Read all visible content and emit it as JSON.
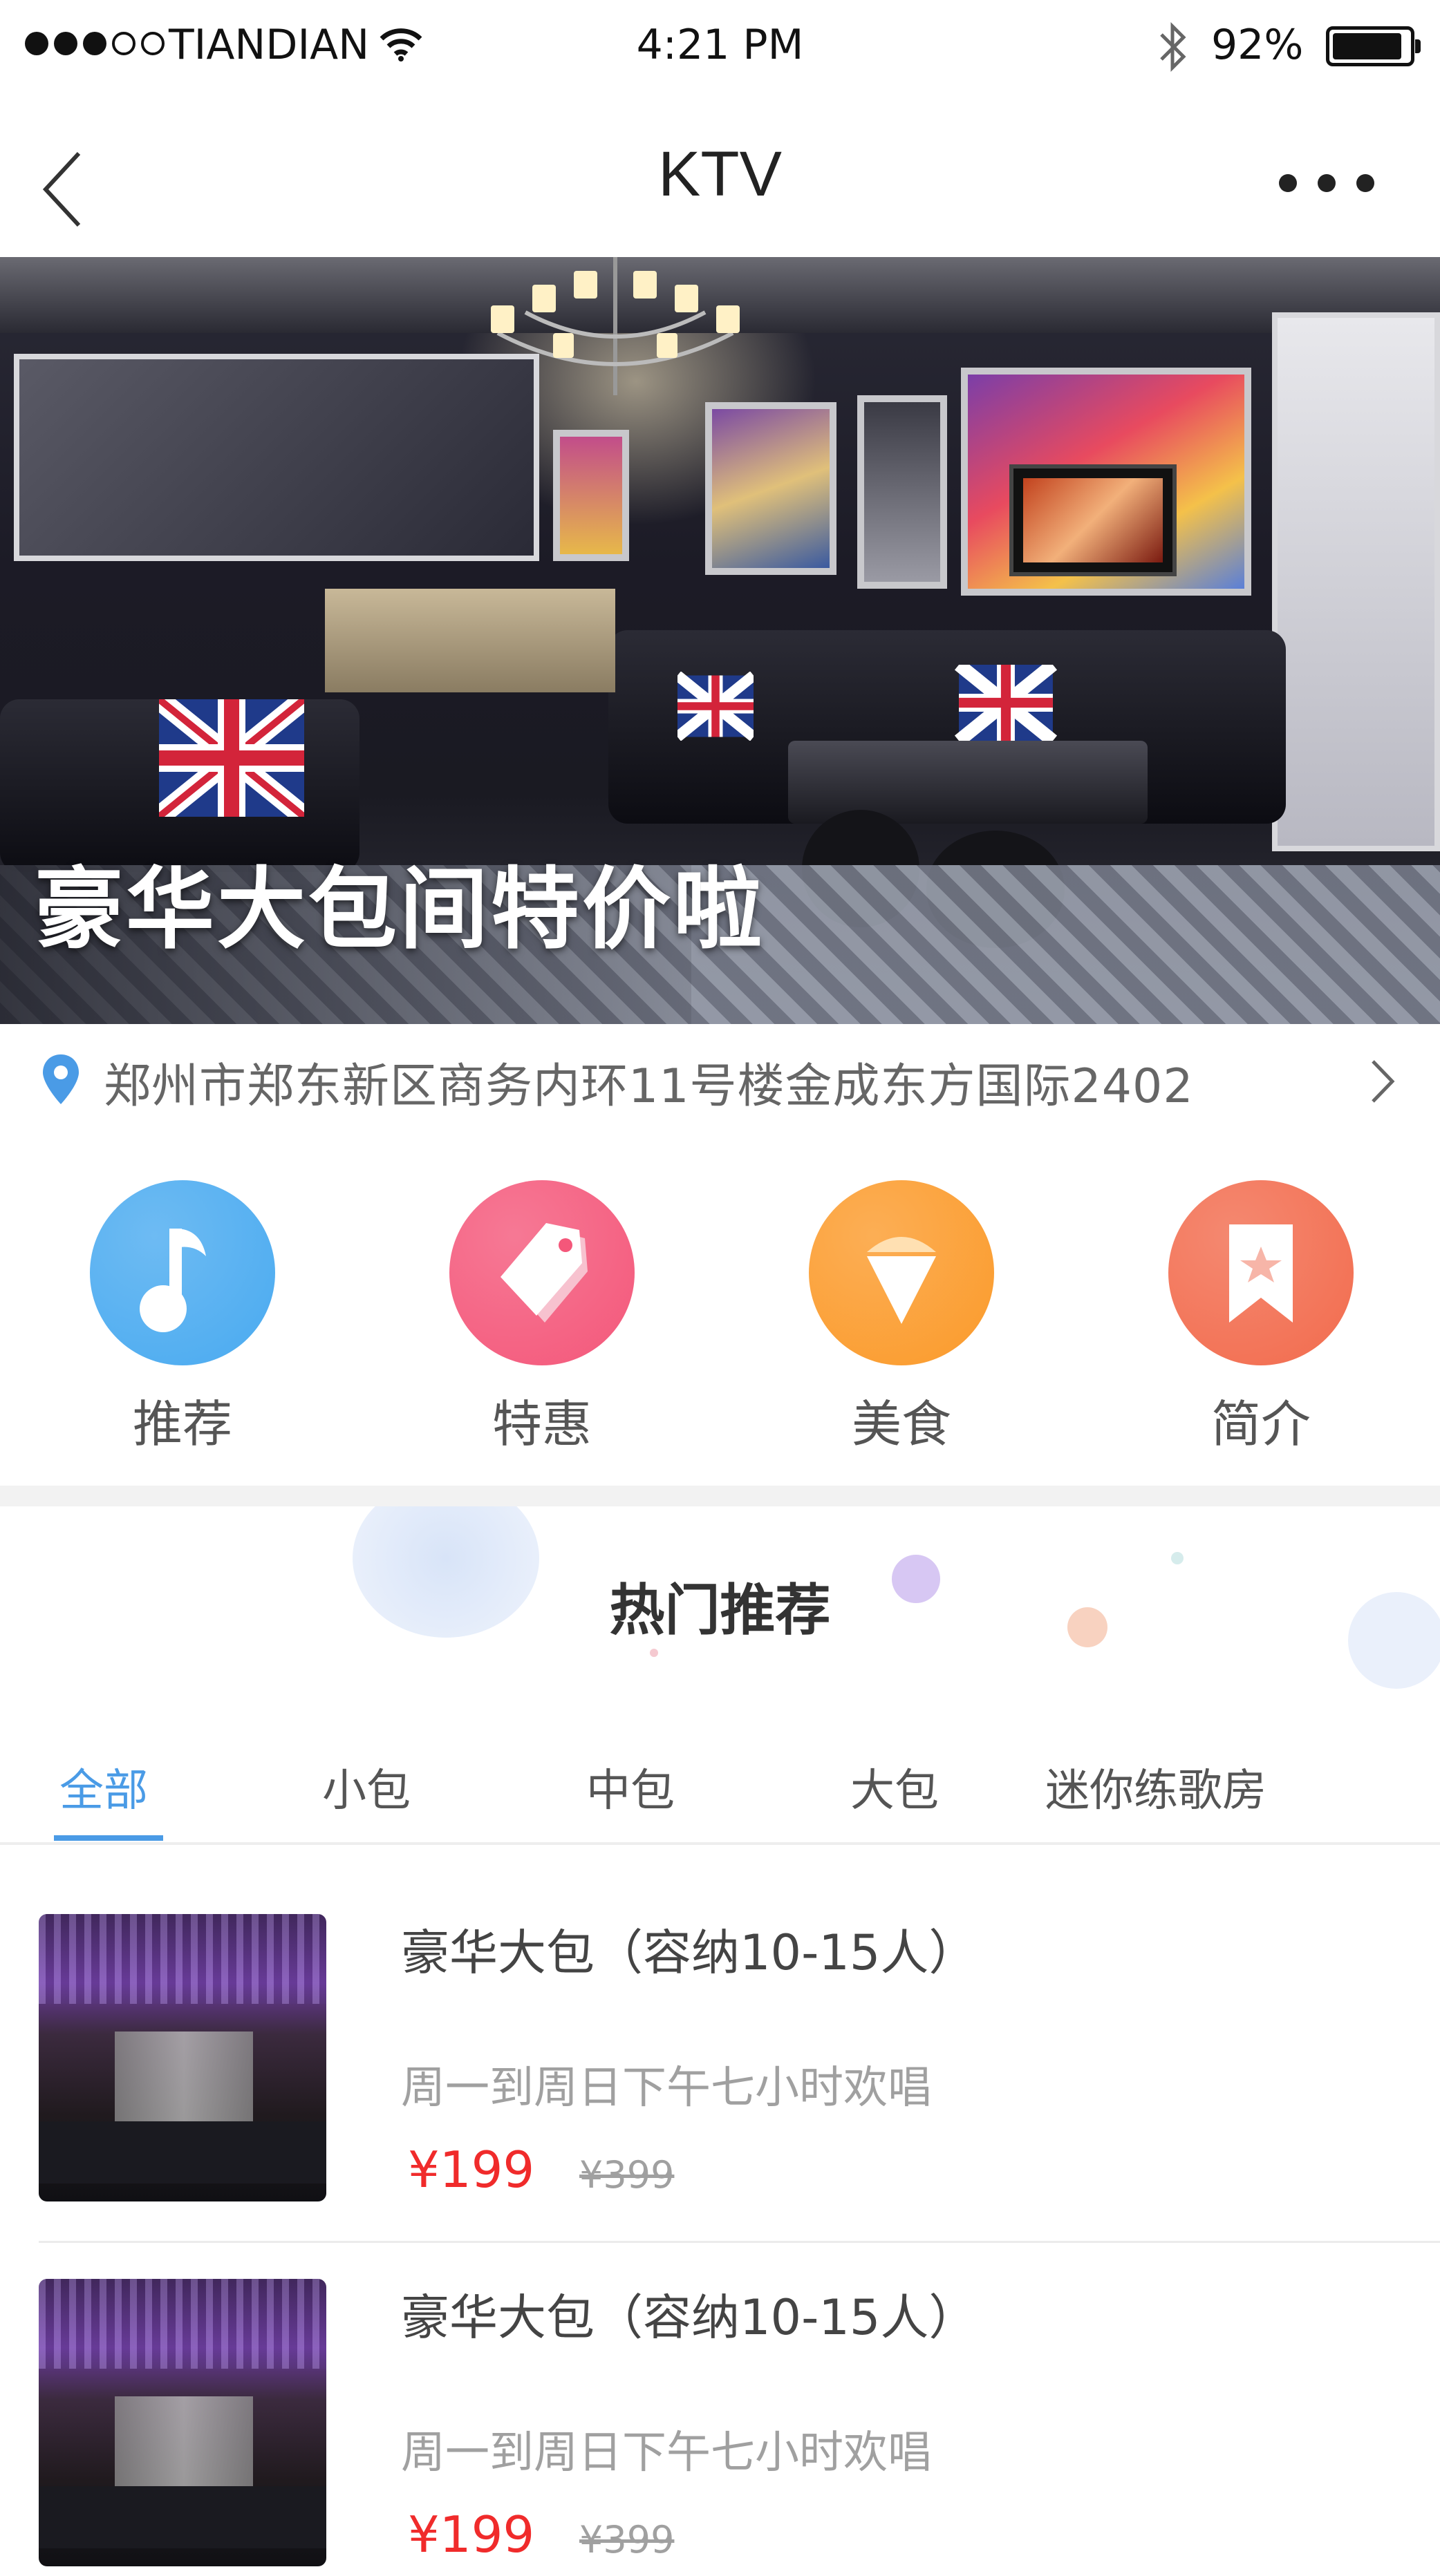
{
  "status_bar": {
    "carrier": "TIANDIAN",
    "time": "4:21 PM",
    "battery": "92%",
    "battery_level": 0.92,
    "signal_bars_filled": 3,
    "signal_bars_total": 5
  },
  "nav": {
    "title": "KTV"
  },
  "banner": {
    "caption": "豪华大包间特价啦",
    "slide_count": 3,
    "active_slide": 1
  },
  "address": {
    "text": "郑州市郑东新区商务内环11号楼金成东方国际2402"
  },
  "categories": [
    {
      "label": "推荐",
      "icon": "music-note-icon",
      "color": "#49aaf0"
    },
    {
      "label": "特惠",
      "icon": "price-tag-icon",
      "color": "#f4577a"
    },
    {
      "label": "美食",
      "icon": "ice-cream-icon",
      "color": "#fb9a2a"
    },
    {
      "label": "简介",
      "icon": "bookmark-star-icon",
      "color": "#f26b4d"
    }
  ],
  "hot_section": {
    "title": "热门推荐"
  },
  "tabs": [
    {
      "label": "全部",
      "active": true
    },
    {
      "label": "小包",
      "active": false
    },
    {
      "label": "中包",
      "active": false
    },
    {
      "label": "大包",
      "active": false
    },
    {
      "label": "迷你练歌房",
      "active": false
    }
  ],
  "items": [
    {
      "title": "豪华大包（容纳10-15人）",
      "desc": "周一到周日下午七小时欢唱",
      "price": "¥199",
      "old_price": "¥399"
    },
    {
      "title": "豪华大包（容纳10-15人）",
      "desc": "周一到周日下午七小时欢唱",
      "price": "¥199",
      "old_price": "¥399"
    }
  ],
  "colors": {
    "accent": "#4a9be6",
    "price": "#f02b2b"
  }
}
